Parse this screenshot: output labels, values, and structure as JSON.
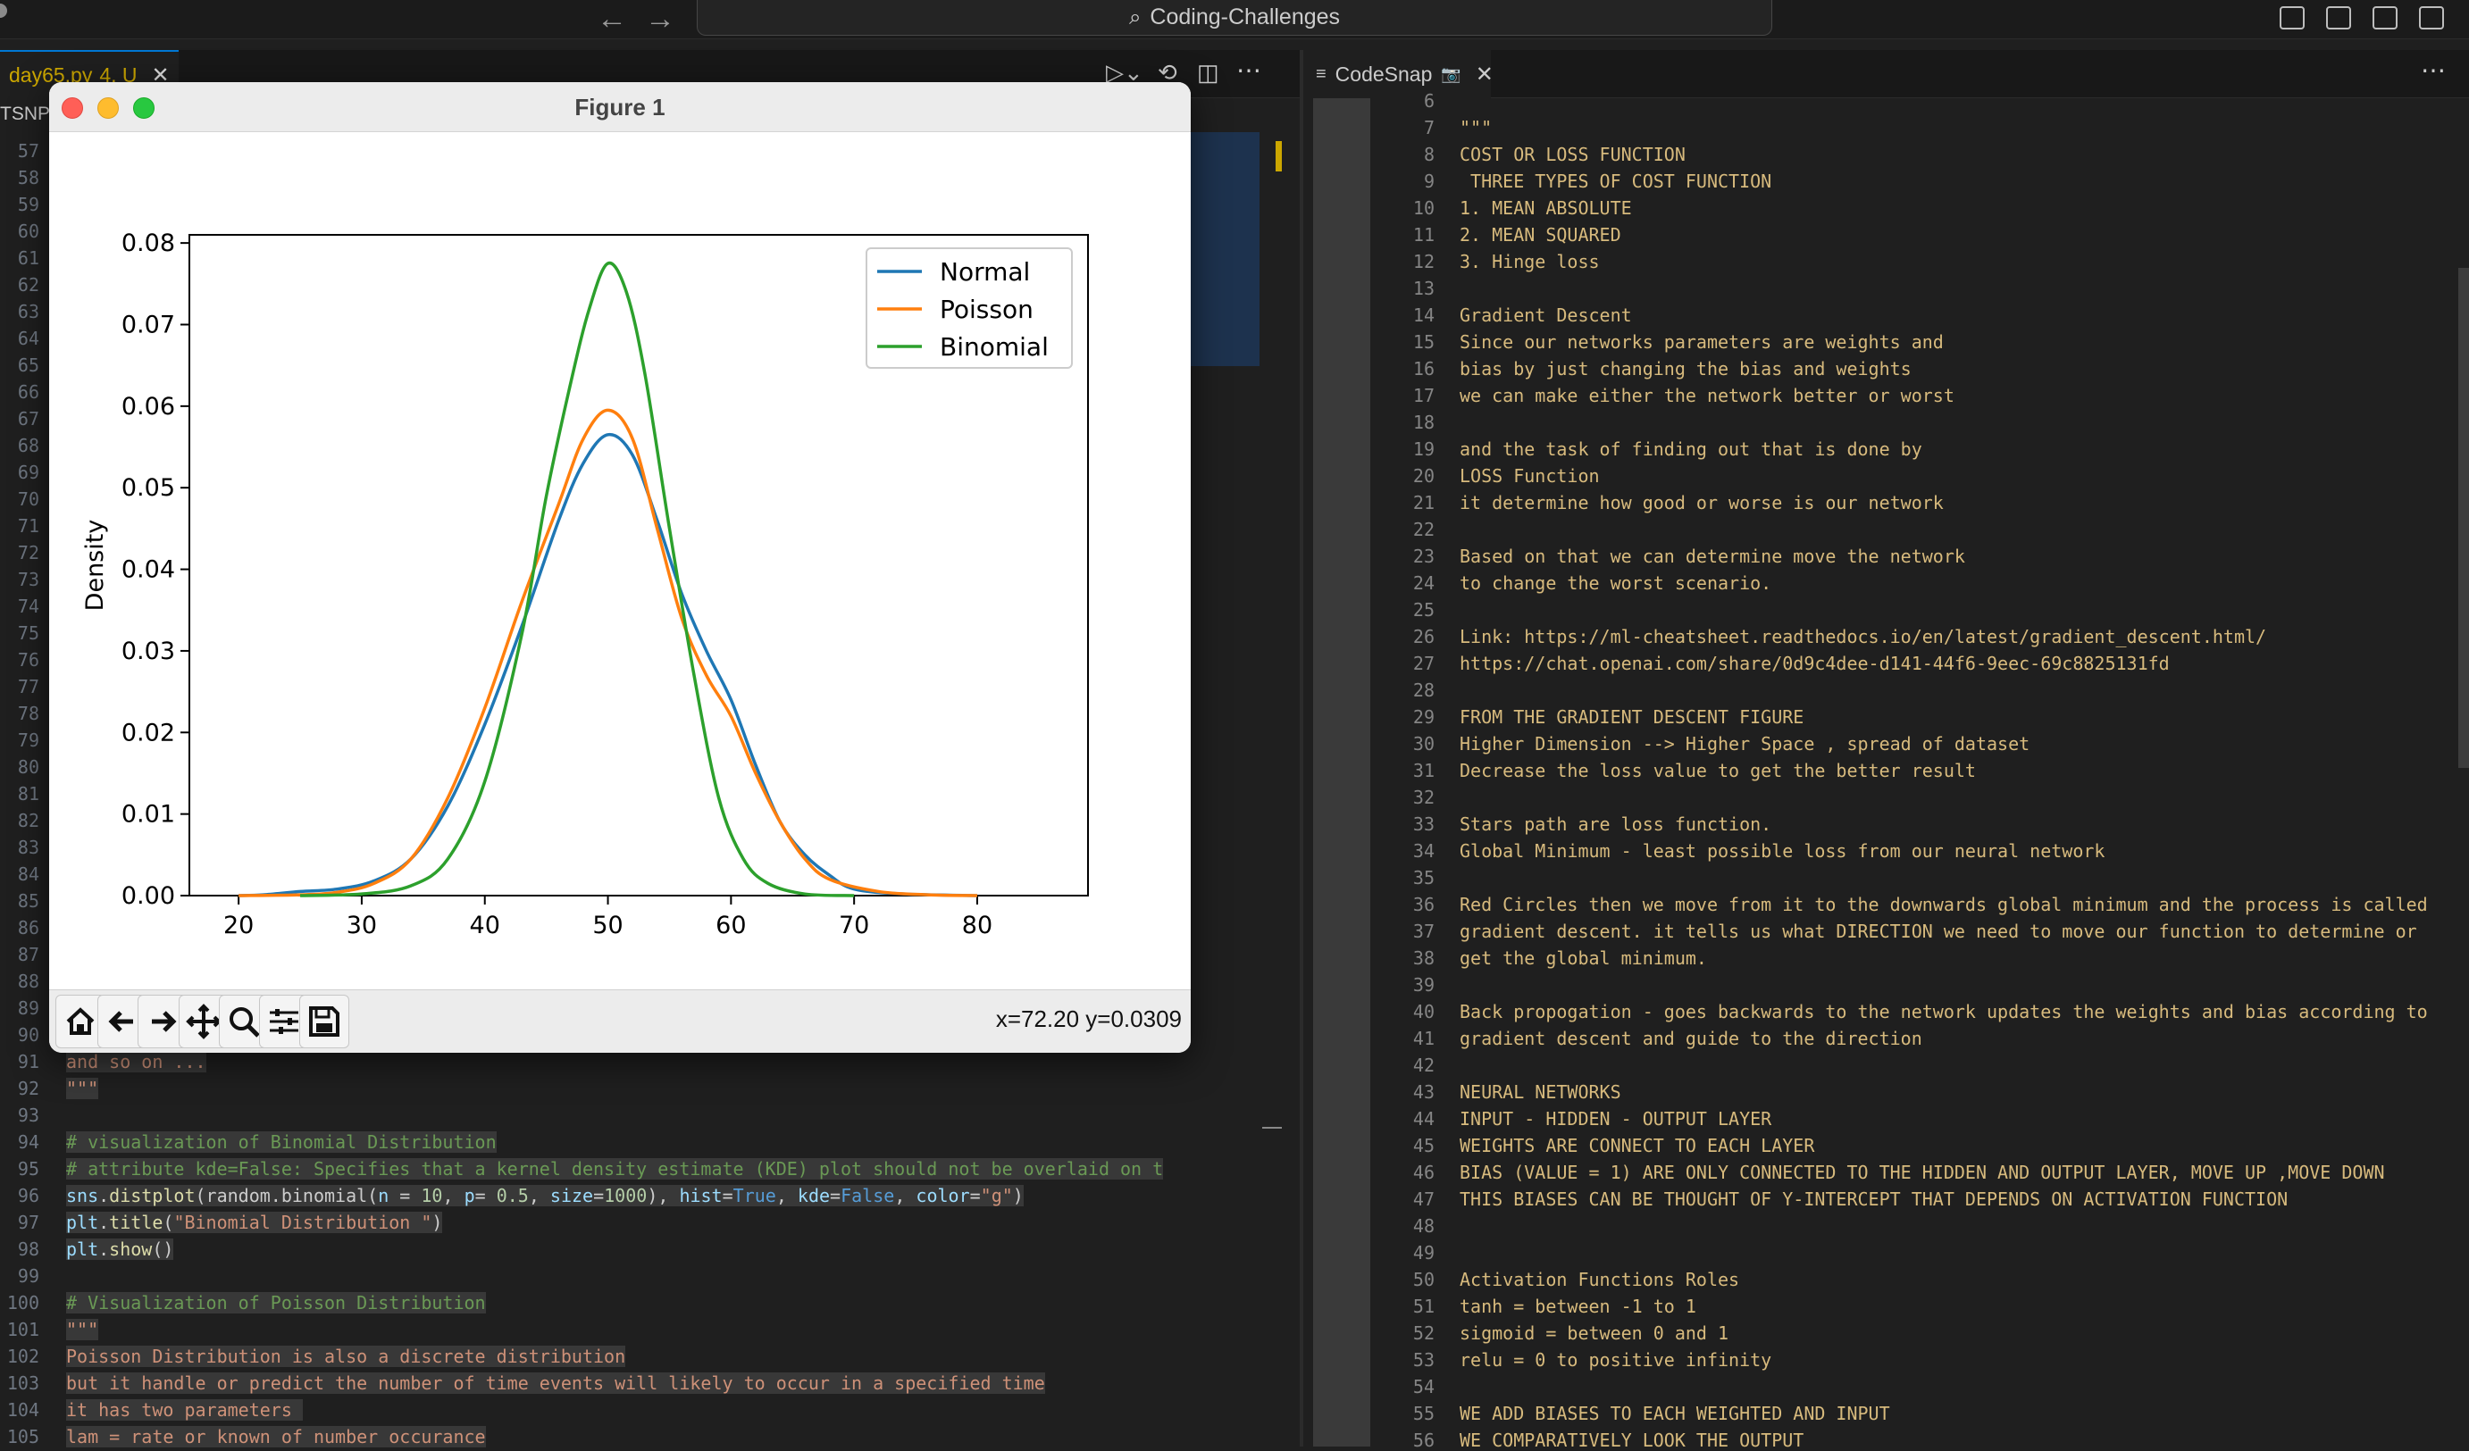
{
  "titlebar": {
    "search_text": "Coding-Challenges",
    "back_icon": "arrow-left-icon",
    "forward_icon": "arrow-right-icon"
  },
  "left_editor": {
    "tab": {
      "filename": "day65.py",
      "status": "4, U"
    },
    "breadcrumb": "TSNP",
    "lines": [
      {
        "n": "57",
        "segs": []
      },
      {
        "n": "58",
        "segs": []
      },
      {
        "n": "59",
        "segs": []
      },
      {
        "n": "60",
        "segs": []
      },
      {
        "n": "61",
        "segs": []
      },
      {
        "n": "62",
        "segs": []
      },
      {
        "n": "63",
        "segs": []
      },
      {
        "n": "64",
        "segs": []
      },
      {
        "n": "65",
        "segs": []
      },
      {
        "n": "66",
        "segs": []
      },
      {
        "n": "67",
        "segs": []
      },
      {
        "n": "68",
        "segs": []
      },
      {
        "n": "69",
        "segs": []
      },
      {
        "n": "70",
        "segs": []
      },
      {
        "n": "71",
        "segs": []
      },
      {
        "n": "72",
        "segs": []
      },
      {
        "n": "73",
        "segs": []
      },
      {
        "n": "74",
        "segs": []
      },
      {
        "n": "75",
        "segs": []
      },
      {
        "n": "76",
        "segs": []
      },
      {
        "n": "77",
        "segs": []
      },
      {
        "n": "78",
        "segs": []
      },
      {
        "n": "79",
        "segs": []
      },
      {
        "n": "80",
        "segs": []
      },
      {
        "n": "81",
        "segs": []
      },
      {
        "n": "82",
        "segs": []
      },
      {
        "n": "83",
        "segs": []
      },
      {
        "n": "84",
        "segs": []
      },
      {
        "n": "85",
        "segs": []
      },
      {
        "n": "86",
        "segs": []
      },
      {
        "n": "87",
        "segs": []
      },
      {
        "n": "88",
        "segs": []
      },
      {
        "n": "89",
        "segs": []
      },
      {
        "n": "90",
        "segs": []
      },
      {
        "n": "91",
        "segs": [
          {
            "t": "and so on ...",
            "c": "str"
          }
        ]
      },
      {
        "n": "92",
        "segs": [
          {
            "t": "\"\"\"",
            "c": "str"
          }
        ]
      },
      {
        "n": "93",
        "segs": []
      },
      {
        "n": "94",
        "segs": [
          {
            "t": "# visualization of Binomial Distribution",
            "c": "cm"
          }
        ]
      },
      {
        "n": "95",
        "segs": [
          {
            "t": "# attribute kde=False: Specifies that a kernel density estimate (KDE) plot should not be overlaid on t",
            "c": "cm"
          }
        ]
      },
      {
        "n": "96",
        "segs": [
          {
            "t": "sns",
            "c": "pm"
          },
          {
            "t": ".",
            "c": ""
          },
          {
            "t": "distplot",
            "c": "fn"
          },
          {
            "t": "(random.binomial(",
            "c": ""
          },
          {
            "t": "n",
            "c": "pm"
          },
          {
            "t": " = ",
            "c": ""
          },
          {
            "t": "10",
            "c": "num"
          },
          {
            "t": ", ",
            "c": ""
          },
          {
            "t": "p",
            "c": "pm"
          },
          {
            "t": "= ",
            "c": ""
          },
          {
            "t": "0.5",
            "c": "num"
          },
          {
            "t": ", ",
            "c": ""
          },
          {
            "t": "size",
            "c": "pm"
          },
          {
            "t": "=",
            "c": ""
          },
          {
            "t": "1000",
            "c": "num"
          },
          {
            "t": "), ",
            "c": ""
          },
          {
            "t": "hist",
            "c": "pm"
          },
          {
            "t": "=",
            "c": ""
          },
          {
            "t": "True",
            "c": "kw"
          },
          {
            "t": ", ",
            "c": ""
          },
          {
            "t": "kde",
            "c": "pm"
          },
          {
            "t": "=",
            "c": ""
          },
          {
            "t": "False",
            "c": "kw"
          },
          {
            "t": ", ",
            "c": ""
          },
          {
            "t": "color",
            "c": "pm"
          },
          {
            "t": "=",
            "c": ""
          },
          {
            "t": "\"g\"",
            "c": "str"
          },
          {
            "t": ")",
            "c": ""
          }
        ]
      },
      {
        "n": "97",
        "segs": [
          {
            "t": "plt",
            "c": "pm"
          },
          {
            "t": ".",
            "c": ""
          },
          {
            "t": "title",
            "c": "fn"
          },
          {
            "t": "(",
            "c": ""
          },
          {
            "t": "\"Binomial Distribution \"",
            "c": "str"
          },
          {
            "t": ")",
            "c": ""
          }
        ]
      },
      {
        "n": "98",
        "segs": [
          {
            "t": "plt",
            "c": "pm"
          },
          {
            "t": ".",
            "c": ""
          },
          {
            "t": "show",
            "c": "fn"
          },
          {
            "t": "()",
            "c": ""
          }
        ]
      },
      {
        "n": "99",
        "segs": []
      },
      {
        "n": "100",
        "segs": [
          {
            "t": "# Visualization of Poisson Distribution",
            "c": "cm"
          }
        ]
      },
      {
        "n": "101",
        "segs": [
          {
            "t": "\"\"\"",
            "c": "str"
          }
        ]
      },
      {
        "n": "102",
        "segs": [
          {
            "t": "Poisson Distribution is also a discrete distribution",
            "c": "str"
          }
        ]
      },
      {
        "n": "103",
        "segs": [
          {
            "t": "but it handle or predict the number of time events will likely to occur in a specified time",
            "c": "str"
          }
        ]
      },
      {
        "n": "104",
        "segs": [
          {
            "t": "it has two parameters ",
            "c": "str"
          }
        ]
      },
      {
        "n": "105",
        "segs": [
          {
            "t": "lam = rate or known of number occurance",
            "c": "str"
          }
        ]
      }
    ]
  },
  "right_editor": {
    "tab": {
      "label": "CodeSnap"
    },
    "lines": [
      {
        "n": "6",
        "t": ""
      },
      {
        "n": "7",
        "t": "\"\"\""
      },
      {
        "n": "8",
        "t": "COST OR LOSS FUNCTION"
      },
      {
        "n": "9",
        "t": " THREE TYPES OF COST FUNCTION"
      },
      {
        "n": "10",
        "t": "1. MEAN ABSOLUTE"
      },
      {
        "n": "11",
        "t": "2. MEAN SQUARED"
      },
      {
        "n": "12",
        "t": "3. Hinge loss"
      },
      {
        "n": "13",
        "t": ""
      },
      {
        "n": "14",
        "t": "Gradient Descent"
      },
      {
        "n": "15",
        "t": "Since our networks parameters are weights and"
      },
      {
        "n": "16",
        "t": "bias by just changing the bias and weights"
      },
      {
        "n": "17",
        "t": "we can make either the network better or worst"
      },
      {
        "n": "18",
        "t": ""
      },
      {
        "n": "19",
        "t": "and the task of finding out that is done by"
      },
      {
        "n": "20",
        "t": "LOSS Function"
      },
      {
        "n": "21",
        "t": "it determine how good or worse is our network"
      },
      {
        "n": "22",
        "t": ""
      },
      {
        "n": "23",
        "t": "Based on that we can determine move the network"
      },
      {
        "n": "24",
        "t": "to change the worst scenario."
      },
      {
        "n": "25",
        "t": ""
      },
      {
        "n": "26",
        "t": "Link: https://ml-cheatsheet.readthedocs.io/en/latest/gradient_descent.html/"
      },
      {
        "n": "27",
        "t": "https://chat.openai.com/share/0d9c4dee-d141-44f6-9eec-69c8825131fd"
      },
      {
        "n": "28",
        "t": ""
      },
      {
        "n": "29",
        "t": "FROM THE GRADIENT DESCENT FIGURE"
      },
      {
        "n": "30",
        "t": "Higher Dimension --> Higher Space , spread of dataset"
      },
      {
        "n": "31",
        "t": "Decrease the loss value to get the better result"
      },
      {
        "n": "32",
        "t": ""
      },
      {
        "n": "33",
        "t": "Stars path are loss function."
      },
      {
        "n": "34",
        "t": "Global Minimum - least possible loss from our neural network"
      },
      {
        "n": "35",
        "t": ""
      },
      {
        "n": "36",
        "t": "Red Circles then we move from it to the downwards global minimum and the process is called"
      },
      {
        "n": "37",
        "t": "gradient descent. it tells us what DIRECTION we need to move our function to determine or"
      },
      {
        "n": "38",
        "t": "get the global minimum."
      },
      {
        "n": "39",
        "t": ""
      },
      {
        "n": "40",
        "t": "Back propogation - goes backwards to the network updates the weights and bias according to"
      },
      {
        "n": "41",
        "t": "gradient descent and guide to the direction"
      },
      {
        "n": "42",
        "t": ""
      },
      {
        "n": "43",
        "t": "NEURAL NETWORKS"
      },
      {
        "n": "44",
        "t": "INPUT - HIDDEN - OUTPUT LAYER"
      },
      {
        "n": "45",
        "t": "WEIGHTS ARE CONNECT TO EACH LAYER"
      },
      {
        "n": "46",
        "t": "BIAS (VALUE = 1) ARE ONLY CONNECTED TO THE HIDDEN AND OUTPUT LAYER, MOVE UP ,MOVE DOWN"
      },
      {
        "n": "47",
        "t": "THIS BIASES CAN BE THOUGHT OF Y-INTERCEPT THAT DEPENDS ON ACTIVATION FUNCTION"
      },
      {
        "n": "48",
        "t": ""
      },
      {
        "n": "49",
        "t": ""
      },
      {
        "n": "50",
        "t": "Activation Functions Roles"
      },
      {
        "n": "51",
        "t": "tanh = between -1 to 1"
      },
      {
        "n": "52",
        "t": "sigmoid = between 0 and 1"
      },
      {
        "n": "53",
        "t": "relu = 0 to positive infinity"
      },
      {
        "n": "54",
        "t": ""
      },
      {
        "n": "55",
        "t": "WE ADD BIASES TO EACH WEIGHTED AND INPUT"
      },
      {
        "n": "56",
        "t": "WE COMPARATIVELY LOOK THE OUTPUT"
      }
    ]
  },
  "figure": {
    "window_title": "Figure 1",
    "coords_readout": "x=72.20 y=0.0309",
    "toolbar_icons": [
      "home-icon",
      "back-arrow-icon",
      "forward-arrow-icon",
      "pan-icon",
      "zoom-icon",
      "configure-subplots-icon",
      "save-icon"
    ]
  },
  "chart_data": {
    "type": "line",
    "title": "",
    "xlabel": "",
    "ylabel": "Density",
    "xlim": [
      16,
      89
    ],
    "ylim": [
      0,
      0.081
    ],
    "xticks": [
      20,
      30,
      40,
      50,
      60,
      70,
      80
    ],
    "yticks": [
      "0.00",
      "0.01",
      "0.02",
      "0.03",
      "0.04",
      "0.05",
      "0.06",
      "0.07",
      "0.08"
    ],
    "legend_position": "top-right",
    "grid": false,
    "series": [
      {
        "name": "Normal",
        "color": "#1f77b4",
        "points": [
          [
            20,
            0
          ],
          [
            22,
            0.0001
          ],
          [
            25,
            0.0005
          ],
          [
            28,
            0.0008
          ],
          [
            31,
            0.0018
          ],
          [
            34,
            0.0045
          ],
          [
            37,
            0.011
          ],
          [
            40,
            0.021
          ],
          [
            43,
            0.033
          ],
          [
            46,
            0.046
          ],
          [
            48,
            0.053
          ],
          [
            50,
            0.0565
          ],
          [
            52,
            0.054
          ],
          [
            54,
            0.046
          ],
          [
            56,
            0.037
          ],
          [
            58,
            0.03
          ],
          [
            60,
            0.024
          ],
          [
            62,
            0.016
          ],
          [
            64,
            0.009
          ],
          [
            66,
            0.005
          ],
          [
            68,
            0.0025
          ],
          [
            70,
            0.0008
          ],
          [
            74,
            0.0002
          ],
          [
            80,
            0
          ]
        ]
      },
      {
        "name": "Poisson",
        "color": "#ff7f0e",
        "points": [
          [
            20,
            0
          ],
          [
            25,
            0.0001
          ],
          [
            28,
            0.0004
          ],
          [
            31,
            0.0015
          ],
          [
            34,
            0.0045
          ],
          [
            37,
            0.012
          ],
          [
            40,
            0.023
          ],
          [
            43,
            0.036
          ],
          [
            46,
            0.048
          ],
          [
            48,
            0.056
          ],
          [
            50,
            0.0595
          ],
          [
            52,
            0.056
          ],
          [
            54,
            0.045
          ],
          [
            56,
            0.034
          ],
          [
            58,
            0.027
          ],
          [
            60,
            0.022
          ],
          [
            62,
            0.015
          ],
          [
            64,
            0.009
          ],
          [
            66,
            0.0045
          ],
          [
            68,
            0.002
          ],
          [
            72,
            0.0005
          ],
          [
            76,
            0.0001
          ],
          [
            80,
            0
          ]
        ]
      },
      {
        "name": "Binomial",
        "color": "#2ca02c",
        "points": [
          [
            25,
            0
          ],
          [
            30,
            0.0002
          ],
          [
            34,
            0.0012
          ],
          [
            37,
            0.0045
          ],
          [
            40,
            0.014
          ],
          [
            43,
            0.032
          ],
          [
            45,
            0.049
          ],
          [
            47,
            0.063
          ],
          [
            48.5,
            0.072
          ],
          [
            50,
            0.0775
          ],
          [
            51.5,
            0.074
          ],
          [
            53,
            0.064
          ],
          [
            55,
            0.045
          ],
          [
            57,
            0.027
          ],
          [
            59,
            0.012
          ],
          [
            61,
            0.0045
          ],
          [
            63,
            0.0015
          ],
          [
            66,
            0.0002
          ],
          [
            70,
            0
          ]
        ]
      }
    ]
  }
}
